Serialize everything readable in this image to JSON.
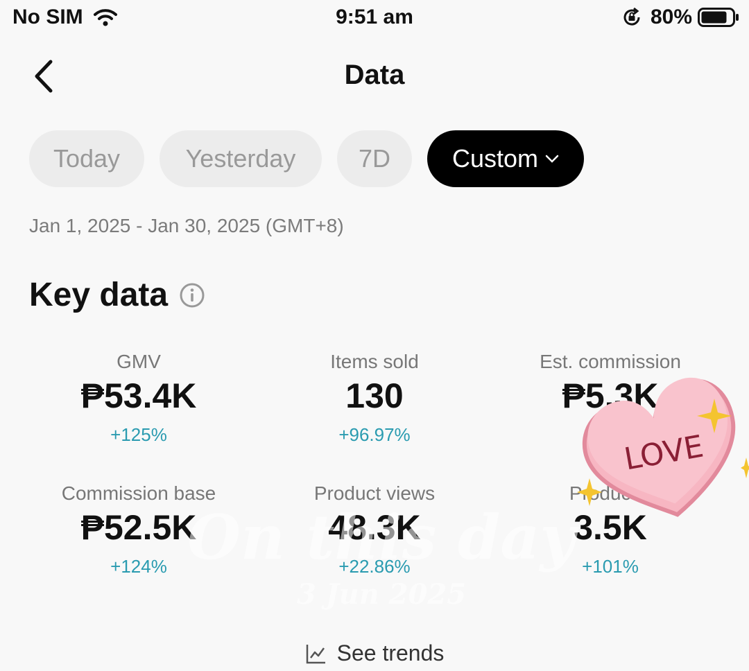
{
  "status_bar": {
    "carrier": "No SIM",
    "time": "9:51 am",
    "battery": "80%"
  },
  "header": {
    "title": "Data"
  },
  "period_tabs": [
    {
      "label": "Today",
      "selected": false
    },
    {
      "label": "Yesterday",
      "selected": false
    },
    {
      "label": "7D",
      "selected": false
    },
    {
      "label": "Custom",
      "selected": true
    }
  ],
  "date_range": "Jan 1, 2025 - Jan 30, 2025 (GMT+8)",
  "key_data": {
    "title": "Key data",
    "metrics": [
      {
        "label": "GMV",
        "value": "₱53.4K",
        "change": "+125%"
      },
      {
        "label": "Items sold",
        "value": "130",
        "change": "+96.97%"
      },
      {
        "label": "Est. commission",
        "value": "₱5.3K",
        "change": "+"
      },
      {
        "label": "Commission base",
        "value": "₱52.5K",
        "change": "+124%"
      },
      {
        "label": "Product views",
        "value": "48.3K",
        "change": "+22.86%"
      },
      {
        "label": "Product c",
        "value": "3.5K",
        "change": "+101%"
      }
    ]
  },
  "see_trends": "See trends",
  "stickers": {
    "love_text": "LOVE",
    "watermark_text": "On this day",
    "watermark_date": "3 Jun 2025"
  },
  "colors": {
    "accent_positive": "#2a9bb0",
    "pill_selected_bg": "#000000",
    "pill_bg": "#ececec",
    "heart_pink": "#f5a9b8",
    "sparkle": "#f4c430"
  },
  "icons": {
    "back": "chevron-left-icon",
    "info": "info-icon",
    "trend": "trend-chart-icon",
    "wifi": "wifi-icon",
    "battery": "battery-icon",
    "rotation_lock": "rotation-lock-icon"
  }
}
